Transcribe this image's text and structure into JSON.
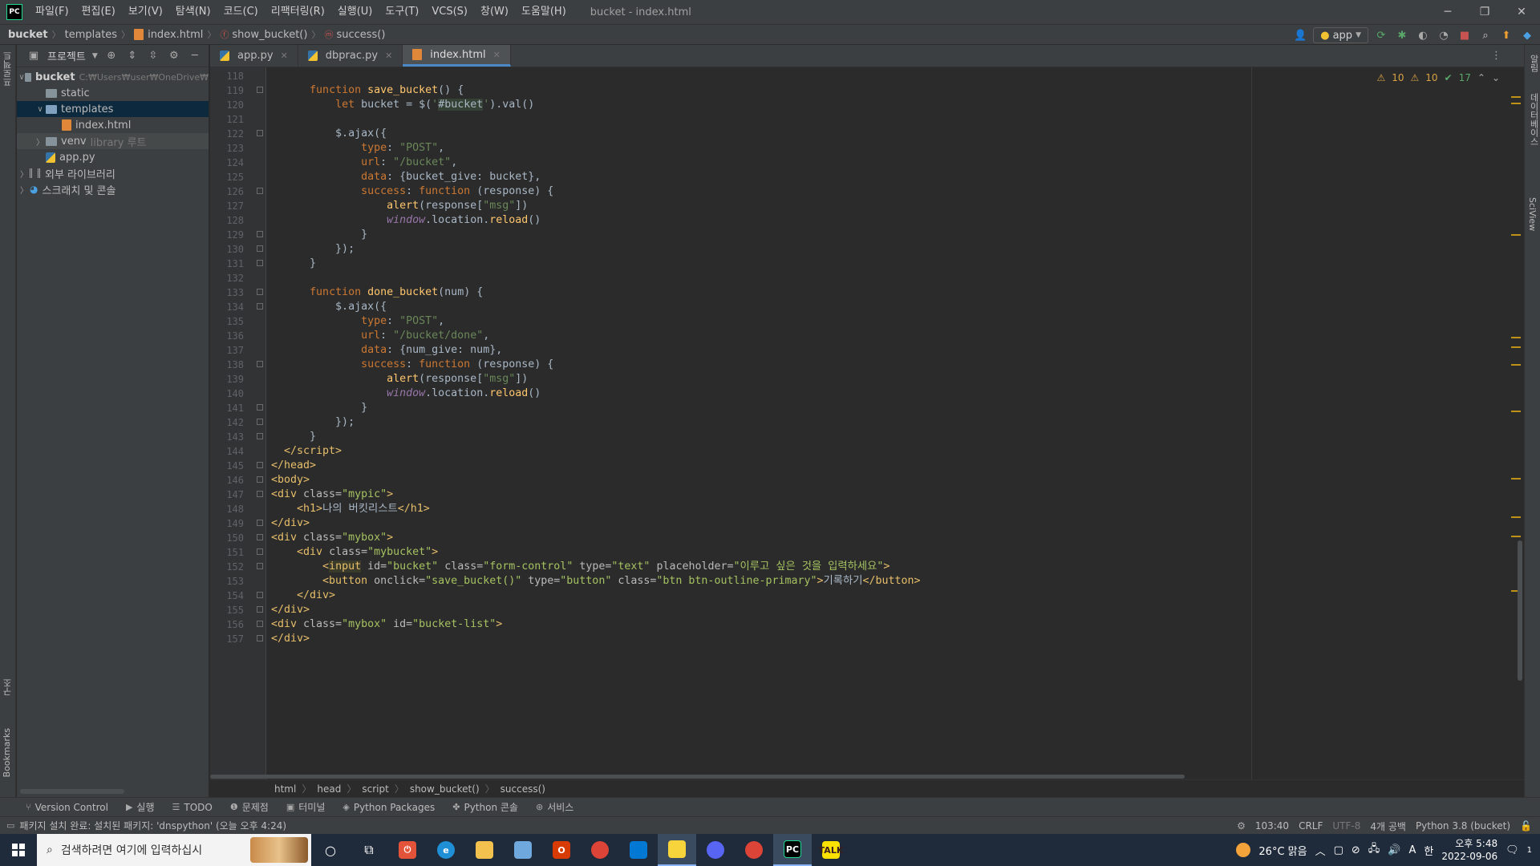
{
  "menubar": {
    "logo": "PC",
    "items": [
      "파일(F)",
      "편집(E)",
      "보기(V)",
      "탐색(N)",
      "코드(C)",
      "리팩터링(R)",
      "실행(U)",
      "도구(T)",
      "VCS(S)",
      "창(W)",
      "도움말(H)"
    ],
    "window_title": "bucket - index.html"
  },
  "navbar": {
    "crumbs": [
      "bucket",
      "templates",
      "index.html",
      "show_bucket()",
      "success()"
    ],
    "run_config": "app"
  },
  "project_panel": {
    "title": "프로젝트",
    "tree": {
      "root_name": "bucket",
      "root_path": "C:₩Users₩user₩OneDrive₩",
      "static": "static",
      "templates": "templates",
      "index_html": "index.html",
      "venv": "venv",
      "venv_hint": "library 루트",
      "app_py": "app.py",
      "external_libs": "외부 라이브러리",
      "scratches": "스크래치 및 콘솔"
    }
  },
  "left_strip": {
    "project_label": "프로젝트",
    "structure_label": "구조",
    "bookmarks_label": "Bookmarks"
  },
  "right_strip": {
    "notifications_label": "알림",
    "database_label": "데이터베이스",
    "sciview_label": "SciView"
  },
  "tabs": [
    {
      "label": "app.py"
    },
    {
      "label": "dbprac.py"
    },
    {
      "label": "index.html"
    }
  ],
  "inspections": {
    "warnings_a": "10",
    "warnings_b": "10",
    "ok": "17"
  },
  "editor": {
    "line_numbers": [
      "118",
      "119",
      "120",
      "121",
      "122",
      "123",
      "124",
      "125",
      "126",
      "127",
      "128",
      "129",
      "130",
      "131",
      "132",
      "133",
      "134",
      "135",
      "136",
      "137",
      "138",
      "139",
      "140",
      "141",
      "142",
      "143",
      "144",
      "145",
      "146",
      "147",
      "148",
      "149",
      "150",
      "151",
      "152",
      "153",
      "154",
      "155",
      "156",
      "157"
    ]
  },
  "breadcrumb": [
    "html",
    "head",
    "script",
    "show_bucket()",
    "success()"
  ],
  "toolwindows": [
    "Version Control",
    "실행",
    "TODO",
    "문제점",
    "터미널",
    "Python Packages",
    "Python 콘솔",
    "서비스"
  ],
  "status": {
    "message": "패키지 설치 완료: 설치된 패키지: 'dnspython' (오늘 오후 4:24)",
    "position": "103:40",
    "line_sep": "CRLF",
    "encoding": "UTF-8",
    "indent": "4개 공백",
    "interpreter": "Python 3.8 (bucket)"
  },
  "taskbar": {
    "search_placeholder": "검색하려면 여기에 입력하십시",
    "weather": "26°C 맑음",
    "time": "오후 5:48",
    "date": "2022-09-06",
    "ime_a": "A",
    "ime_b": "한",
    "notification_count": "1"
  },
  "colors": {
    "accent": "#4a88c7",
    "background": "#2b2b2b",
    "panel": "#3c3f41",
    "warning": "#d9a343"
  }
}
